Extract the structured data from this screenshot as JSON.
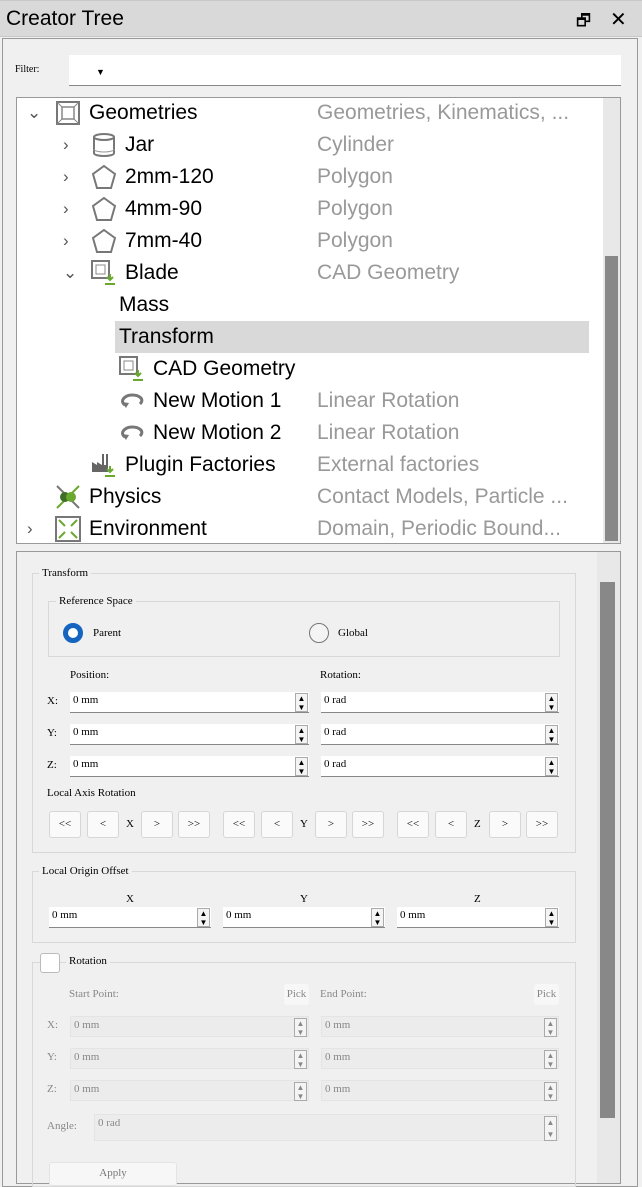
{
  "window": {
    "title": "Creator Tree",
    "float_icon": "restore-icon",
    "close_icon": "close-icon"
  },
  "filter": {
    "label": "Filter:",
    "value": ""
  },
  "tree": [
    {
      "label": "Geometries",
      "desc": "Geometries, Kinematics, ...",
      "icon": "geometry-box-icon",
      "expander": "expanded",
      "depth": 0
    },
    {
      "label": "Jar",
      "desc": "Cylinder",
      "icon": "cylinder-icon",
      "expander": "collapsed",
      "depth": 1
    },
    {
      "label": "2mm-120",
      "desc": "Polygon",
      "icon": "polygon-icon",
      "expander": "collapsed",
      "depth": 1
    },
    {
      "label": "4mm-90",
      "desc": "Polygon",
      "icon": "polygon-icon",
      "expander": "collapsed",
      "depth": 1
    },
    {
      "label": "7mm-40",
      "desc": "Polygon",
      "icon": "polygon-icon",
      "expander": "collapsed",
      "depth": 1
    },
    {
      "label": "Blade",
      "desc": "CAD Geometry",
      "icon": "cad-import-icon",
      "expander": "expanded",
      "depth": 1
    },
    {
      "label": "Mass",
      "desc": "",
      "icon": "",
      "expander": "",
      "depth": 2
    },
    {
      "label": "Transform",
      "desc": "",
      "icon": "",
      "expander": "",
      "depth": 2,
      "selected": true
    },
    {
      "label": "CAD Geometry",
      "desc": "",
      "icon": "cad-import-icon",
      "expander": "",
      "depth": 2
    },
    {
      "label": "New Motion 1",
      "desc": "Linear Rotation",
      "icon": "rotation-icon",
      "expander": "",
      "depth": 2
    },
    {
      "label": "New Motion 2",
      "desc": "Linear Rotation",
      "icon": "rotation-icon",
      "expander": "",
      "depth": 2
    },
    {
      "label": "Plugin Factories",
      "desc": "External factories",
      "icon": "factory-icon",
      "expander": "",
      "depth": 1
    },
    {
      "label": "Physics",
      "desc": "Contact Models, Particle ...",
      "icon": "physics-icon",
      "expander": "",
      "depth": 0
    },
    {
      "label": "Environment",
      "desc": "Domain, Periodic Bound...",
      "icon": "environment-icon",
      "expander": "collapsed",
      "depth": 0
    }
  ],
  "transform": {
    "title": "Transform",
    "reference_space": {
      "title": "Reference Space",
      "options": [
        "Parent",
        "Global"
      ],
      "selected": "Parent"
    },
    "position_label": "Position:",
    "rotation_label": "Rotation:",
    "axes": [
      "X:",
      "Y:",
      "Z:"
    ],
    "position": [
      "0 mm",
      "0 mm",
      "0 mm"
    ],
    "rotation": [
      "0 rad",
      "0 rad",
      "0 rad"
    ],
    "local_axis_rotation": {
      "title": "Local Axis Rotation",
      "axes": [
        "X",
        "Y",
        "Z"
      ],
      "buttons": [
        "<<",
        "<",
        ">",
        ">>"
      ]
    }
  },
  "origin_offset": {
    "title": "Local Origin Offset",
    "axes": [
      "X",
      "Y",
      "Z"
    ],
    "values": [
      "0 mm",
      "0 mm",
      "0 mm"
    ]
  },
  "rotation": {
    "title": "Rotation",
    "checked": false,
    "start_label": "Start Point:",
    "end_label": "End Point:",
    "pick": "Pick",
    "axes": [
      "X:",
      "Y:",
      "Z:"
    ],
    "start": [
      "0 mm",
      "0 mm",
      "0 mm"
    ],
    "end": [
      "0 mm",
      "0 mm",
      "0 mm"
    ],
    "angle_label": "Angle:",
    "angle": "0 rad",
    "apply": "Apply"
  },
  "colors": {
    "accent": "#1565c0",
    "selection": "#d9d9d9",
    "icon_green": "#6aa82f"
  }
}
